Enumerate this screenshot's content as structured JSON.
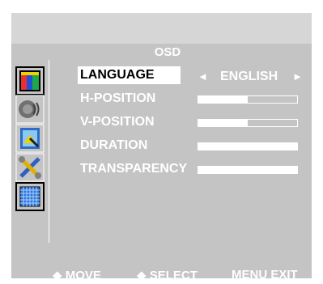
{
  "menu": {
    "title": "OSD",
    "items": [
      {
        "label": "LANGUAGE"
      },
      {
        "label": "H-POSITION",
        "level": 0.5
      },
      {
        "label": "V-POSITION",
        "level": 0.5
      },
      {
        "label": "DURATION",
        "level": 1.0
      },
      {
        "label": "TRANSPARENCY",
        "level": 1.0
      }
    ],
    "language_value": "ENGLISH",
    "arrow_left": "◄",
    "arrow_right": "►"
  },
  "sidebar": {
    "icons": [
      "color-bars-icon",
      "speaker-icon",
      "picture-position-icon",
      "tools-icon",
      "osd-grid-icon"
    ]
  },
  "footer": {
    "move": "◆ MOVE",
    "select": "◆ SELECT",
    "menu_exit": "MENU  EXIT"
  },
  "colors": {
    "panel": "#c4c4c4",
    "text": "#ffffff",
    "selected_bg": "#ffffff",
    "selected_text": "#000000"
  }
}
